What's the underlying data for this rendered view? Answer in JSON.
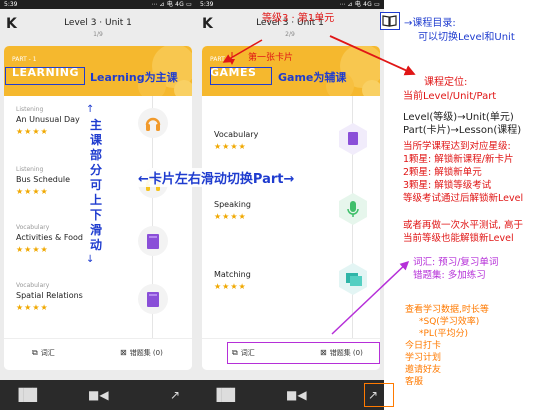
{
  "phone1": {
    "status_time": "5:39",
    "status_right": "⋯ ⊿ 电 4G ▭",
    "back": "K",
    "title": "Level 3 · Unit 1",
    "page": "1/9",
    "part": "PART - 1",
    "category": "LEARNING",
    "lessons": [
      {
        "type": "Listening",
        "name": "An Unusual Day",
        "stars": "★★★★"
      },
      {
        "type": "Listening",
        "name": "Bus Schedule",
        "stars": "★★★★"
      },
      {
        "type": "Vocabulary",
        "name": "Activities & Food",
        "stars": "★★★★"
      },
      {
        "type": "Vocabulary",
        "name": "Spatial Relations",
        "stars": "★★★★"
      }
    ],
    "footer_vocab": "词汇",
    "footer_wrong": "错题集 (0)"
  },
  "phone2": {
    "status_time": "5:39",
    "status_right": "⋯ ⊿ 电 4G ▭",
    "back": "K",
    "title": "Level 3 · Unit 1",
    "page": "2/9",
    "part": "PART - 1",
    "category": "GAMES",
    "lessons": [
      {
        "name": "Vocabulary",
        "stars": "★★★★"
      },
      {
        "name": "Speaking",
        "stars": "★★★★"
      },
      {
        "name": "Matching",
        "stars": "★★★★"
      }
    ],
    "footer_vocab": "词汇",
    "footer_wrong": "错题集 (0)"
  },
  "annotations": {
    "level_unit": "等级3 · 第1单元",
    "first_card": "第一张卡片",
    "learning_main": "Learning为主课",
    "game_aux": "Game为辅课",
    "main_scroll": [
      "主",
      "课",
      "部",
      "分",
      "可",
      "上",
      "下",
      "滑",
      "动"
    ],
    "swipe": "←卡片左右滑动切换Part→",
    "catalog_title": "→课程目录:",
    "catalog_sub": "可以切换Level和Unit",
    "positioning_title": "课程定位:",
    "positioning_sub": "当前Level/Unit/Part",
    "hierarchy_1": "Level(等级)→Unit(单元)",
    "hierarchy_2": "Part(卡片)→Lesson(课程)",
    "stars_lines": [
      "当所学课程达到对应星级:",
      "1颗星: 解锁新课程/新卡片",
      "2颗星: 解锁新单元",
      "3颗星: 解锁等级考试",
      "等级考试通过后解锁新Level"
    ],
    "test_lines": [
      "或者再做一次水平测试, 高于",
      "当前等级也能解锁新Level"
    ],
    "vocab_lines": [
      "词汇: 预习/复习单词",
      "错题集: 多加练习"
    ],
    "data_lines": [
      "查看学习数据,时长等",
      "*SQ(学习效率)",
      "*PL(平均分)",
      "今日打卡",
      "学习计划",
      "邀请好友",
      "客服"
    ]
  },
  "colors": {
    "card_accent": "#f5b82e",
    "annotation_red": "#e01616",
    "annotation_blue": "#1f3ccf",
    "annotation_purple": "#b52fd8",
    "annotation_orange": "#ff7a00"
  }
}
